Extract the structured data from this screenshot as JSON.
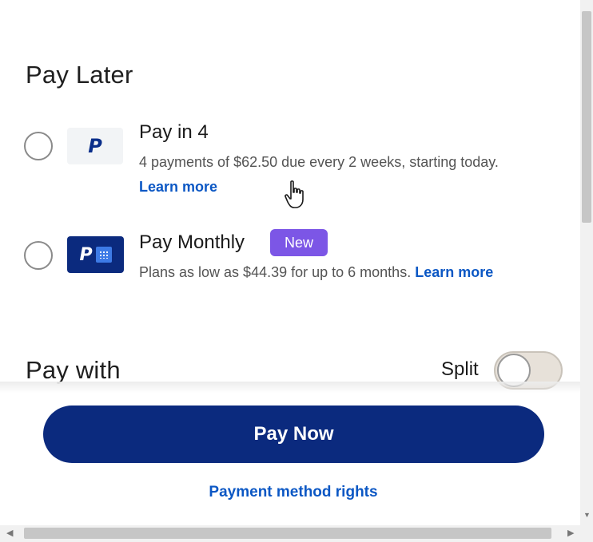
{
  "pay_later": {
    "title": "Pay Later",
    "pay_in_4": {
      "title": "Pay in 4",
      "description": "4 payments of $62.50 due every 2 weeks, starting today.",
      "learn_more": "Learn more",
      "selected": false,
      "logo_text": "P"
    },
    "pay_monthly": {
      "title": "Pay Monthly",
      "badge": "New",
      "description": "Plans as low as $44.39 for up to 6 months.",
      "learn_more": "Learn more",
      "selected": false,
      "logo_text": "P"
    }
  },
  "pay_with": {
    "title": "Pay with",
    "split_label": "Split",
    "split_enabled": false
  },
  "pay_now_label": "Pay Now",
  "payment_rights_link": "Payment method rights",
  "icons": {
    "cursor": "hand-pointer-icon",
    "calendar": "calendar-icon"
  },
  "colors": {
    "primary_button": "#0b2a7e",
    "link": "#0b57c4",
    "badge": "#7c56e6"
  }
}
